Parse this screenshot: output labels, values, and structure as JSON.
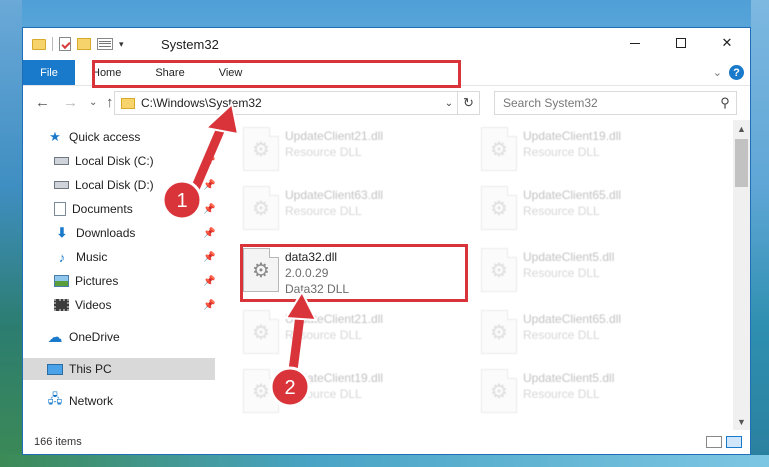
{
  "window": {
    "title": "System32",
    "controls": {
      "minimize": "minimize",
      "maximize": "maximize",
      "close": "✕"
    }
  },
  "ribbon": {
    "tabs": [
      "File",
      "Home",
      "Share",
      "View"
    ],
    "help": "?"
  },
  "navigation": {
    "address": "C:\\Windows\\System32",
    "search_placeholder": "Search System32"
  },
  "sidebar": {
    "items": [
      {
        "label": "Quick access",
        "icon": "star-icon",
        "pinned": false
      },
      {
        "label": "Local Disk (C:)",
        "icon": "drive-icon",
        "pinned": true
      },
      {
        "label": "Local Disk (D:)",
        "icon": "drive-icon",
        "pinned": true
      },
      {
        "label": "Documents",
        "icon": "documents-icon",
        "pinned": true
      },
      {
        "label": "Downloads",
        "icon": "downloads-icon",
        "pinned": true
      },
      {
        "label": "Music",
        "icon": "music-icon",
        "pinned": true
      },
      {
        "label": "Pictures",
        "icon": "pictures-icon",
        "pinned": true
      },
      {
        "label": "Videos",
        "icon": "videos-icon",
        "pinned": true
      },
      {
        "label": "OneDrive",
        "icon": "onedrive-icon",
        "pinned": false
      },
      {
        "label": "This PC",
        "icon": "this-pc-icon",
        "pinned": false,
        "selected": true
      },
      {
        "label": "Network",
        "icon": "network-icon",
        "pinned": false
      }
    ]
  },
  "files": [
    {
      "name": "UpdateClient21.dll",
      "sub": "Resource DLL"
    },
    {
      "name": "UpdateClient19.dll",
      "sub": "Resource DLL"
    },
    {
      "name": "UpdateClient63.dll",
      "sub": "Resource DLL"
    },
    {
      "name": "UpdateClient65.dll",
      "sub": "Resource DLL"
    },
    {
      "name": "data32.dll",
      "version": "2.0.0.29",
      "sub": "Data32 DLL"
    },
    {
      "name": "UpdateClient5.dll",
      "sub": "Resource DLL"
    },
    {
      "name": "UpdateClient21.dll",
      "sub": "Resource DLL"
    },
    {
      "name": "UpdateClient65.dll",
      "sub": "Resource DLL"
    },
    {
      "name": "UpdateClient19.dll",
      "sub": "Resource DLL"
    },
    {
      "name": "UpdateClient5.dll",
      "sub": "Resource DLL"
    }
  ],
  "status": {
    "item_count": "166 items"
  },
  "annotations": {
    "badge1": "1",
    "badge2": "2",
    "color": "#d9343a"
  }
}
